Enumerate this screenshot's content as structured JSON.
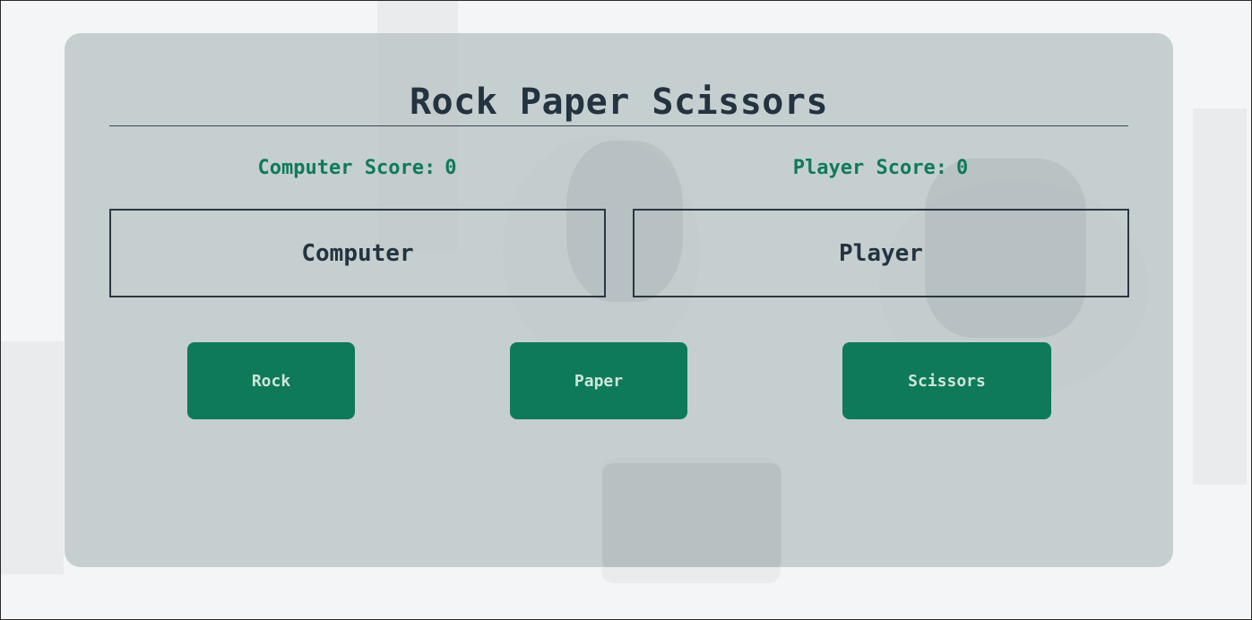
{
  "game": {
    "title": "Rock Paper Scissors",
    "computer_score_label": "Computer Score:",
    "computer_score": "0",
    "player_score_label": "Player Score:",
    "player_score": "0",
    "computer_panel_label": "Computer",
    "player_panel_label": "Player"
  },
  "buttons": {
    "rock": "Rock",
    "paper": "Paper",
    "scissors": "Scissors"
  },
  "colors": {
    "accent": "#0e7a5a",
    "score_text": "#0f7a59",
    "heading_text": "#233340",
    "card_background": "#b7c1c3"
  }
}
